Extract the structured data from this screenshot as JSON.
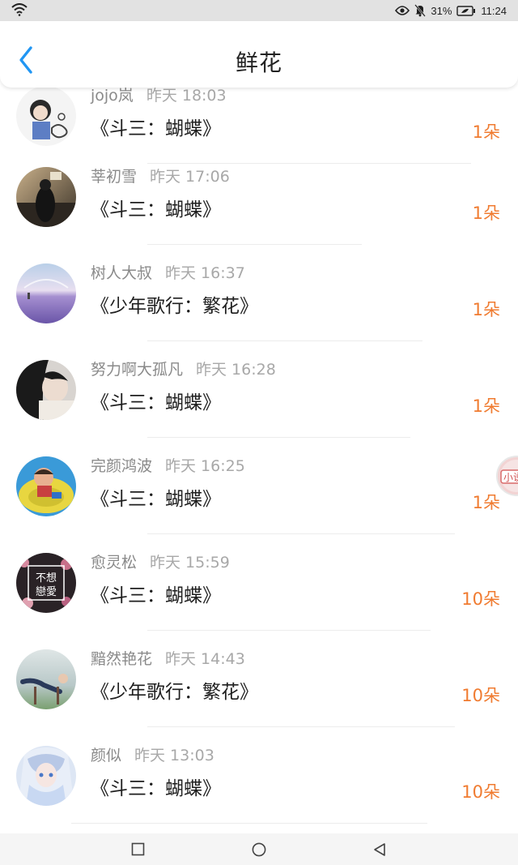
{
  "status_bar": {
    "battery": "31%",
    "time": "11:24",
    "icons": [
      "wifi-icon",
      "eye-icon",
      "bell-muted-icon",
      "battery-icon"
    ]
  },
  "header": {
    "title": "鲜花",
    "back_icon": "back-chevron-icon",
    "accent_color": "#2196f3"
  },
  "items": [
    {
      "name": "jojo岚",
      "time": "昨天 18:03",
      "gift": "《斗三：蝴蝶》",
      "count": "1朵"
    },
    {
      "name": "莘初雪",
      "time": "昨天 17:06",
      "gift": "《斗三：蝴蝶》",
      "count": "1朵"
    },
    {
      "name": "树人大叔",
      "time": "昨天 16:37",
      "gift": "《少年歌行：繁花》",
      "count": "1朵"
    },
    {
      "name": "努力啊大孤凡",
      "time": "昨天 16:28",
      "gift": "《斗三：蝴蝶》",
      "count": "1朵"
    },
    {
      "name": "完颜鸿波",
      "time": "昨天 16:25",
      "gift": "《斗三：蝴蝶》",
      "count": "1朵"
    },
    {
      "name": "愈灵松",
      "time": "昨天 15:59",
      "gift": "《斗三：蝴蝶》",
      "count": "10朵",
      "avatar_text": "不想戀愛"
    },
    {
      "name": "黯然艳花",
      "time": "昨天 14:43",
      "gift": "《少年歌行：繁花》",
      "count": "10朵"
    },
    {
      "name": "颜似",
      "time": "昨天 13:03",
      "gift": "《斗三：蝴蝶》",
      "count": "10朵"
    }
  ],
  "float_widget": {
    "label": "小说"
  },
  "nav_bar": {
    "icons": [
      "recent-apps-icon",
      "home-icon",
      "back-triangle-icon"
    ]
  },
  "colors": {
    "count": "#f07b30",
    "name": "#8a8a8a",
    "time": "#a8a8a8"
  }
}
